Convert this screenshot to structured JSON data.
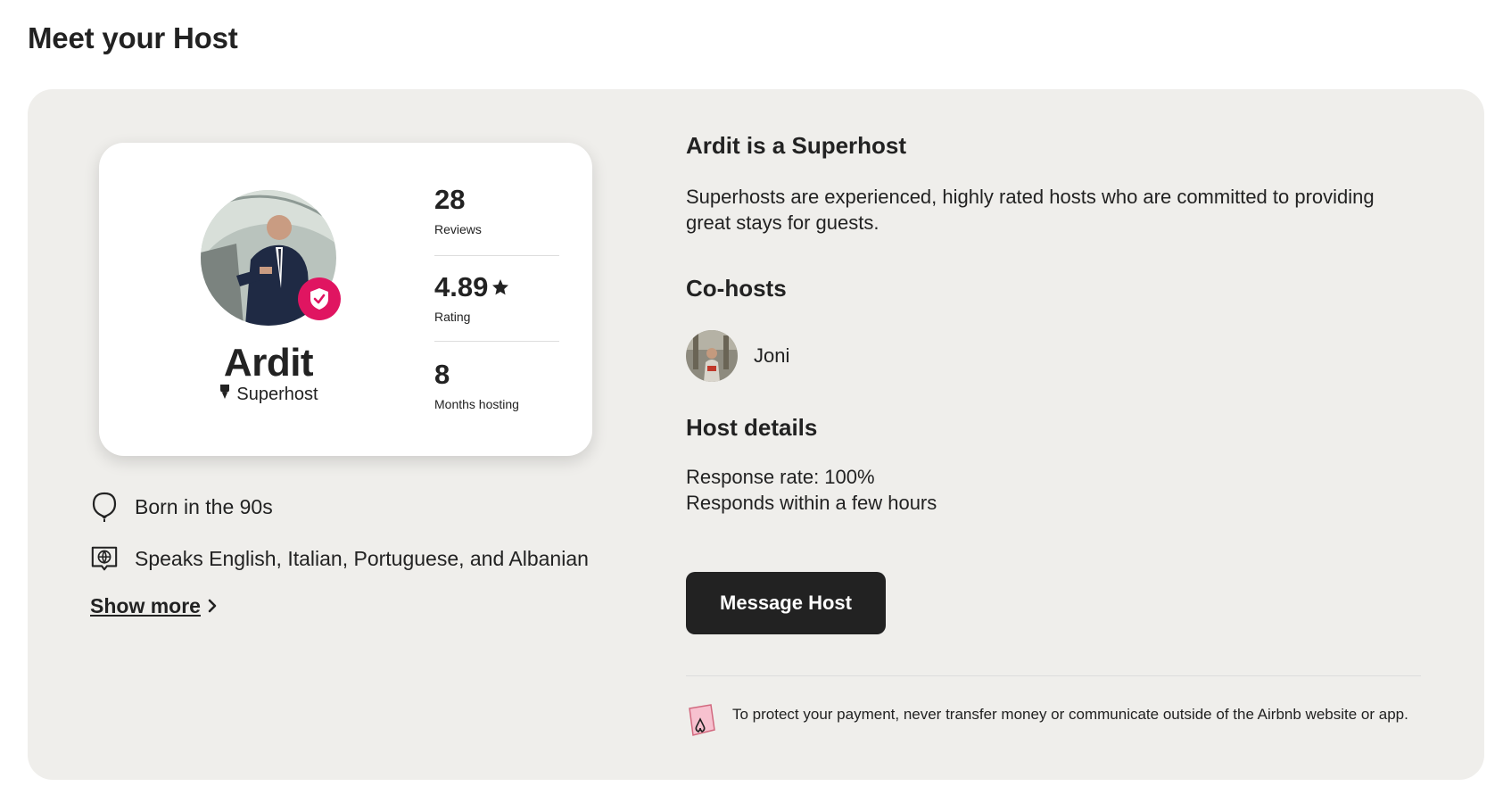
{
  "section_title": "Meet your Host",
  "profile": {
    "name": "Ardit",
    "badge": "Superhost",
    "stats": [
      {
        "value": "28",
        "label": "Reviews"
      },
      {
        "value": "4.89",
        "label": "Rating"
      },
      {
        "value": "8",
        "label": "Months hosting"
      }
    ]
  },
  "facts": [
    {
      "icon": "balloon-icon",
      "text": "Born in the 90s"
    },
    {
      "icon": "language-globe-icon",
      "text": "Speaks English, Italian, Portuguese, and Albanian"
    }
  ],
  "show_more": "Show more",
  "superhost": {
    "title": "Ardit is a Superhost",
    "description": "Superhosts are experienced, highly rated hosts who are committed to providing great stays for guests."
  },
  "cohosts": {
    "title": "Co-hosts",
    "items": [
      {
        "name": "Joni"
      }
    ]
  },
  "host_details": {
    "title": "Host details",
    "response_rate": "Response rate: 100%",
    "response_time": "Responds within a few hours"
  },
  "message_button": "Message Host",
  "notice": "To protect your payment, never transfer money or communicate outside of the Airbnb website or app.",
  "colors": {
    "accent": "#e01561",
    "panel": "#efeeeb",
    "button": "#222222"
  }
}
